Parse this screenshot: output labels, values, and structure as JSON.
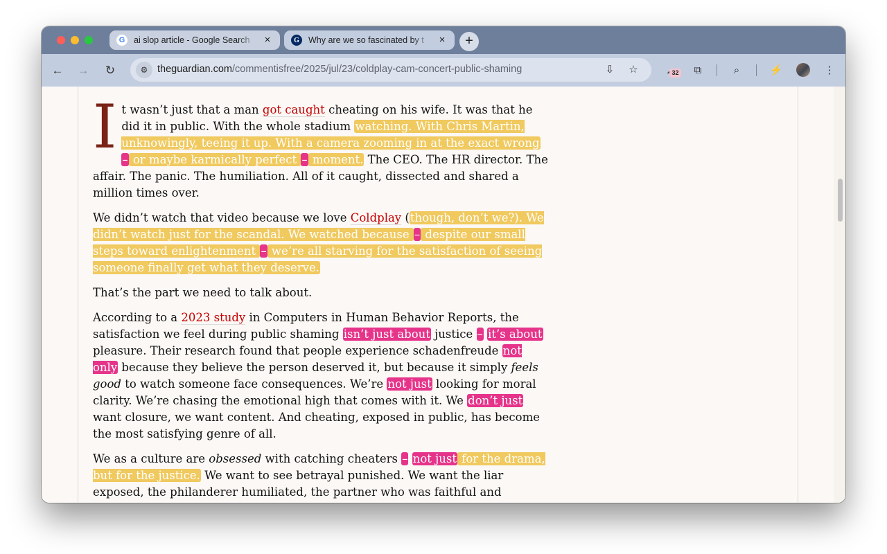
{
  "tabs": [
    {
      "title": "ai slop article - Google Search",
      "favicon": "google-icon",
      "active": false
    },
    {
      "title": "Why are we so fascinated by t",
      "favicon": "guardian-icon",
      "active": true
    }
  ],
  "toolbar": {
    "url_domain": "theguardian.com",
    "url_path": "/commentisfree/2025/jul/23/coldplay-cam-concert-public-shaming",
    "extension_badge": "32"
  },
  "article": {
    "p1": {
      "dropcap": "I",
      "s1": "t wasn’t just that a man ",
      "link": "got caught",
      "s2": " cheating on his wife. It was that he did it in public. With the whole stadium ",
      "h1": "watching. With Chris Martin, unknowingly, teeing it up. With a camera zooming in at the exact wrong",
      "d1": "–",
      "h2": " or maybe karmically perfect ",
      "d2": "–",
      "h3": " moment.",
      "s3": " The CEO. The HR director. The affair. The panic. The humiliation. All of it caught, dissected and shared a million times over."
    },
    "p2": {
      "s1": "We didn’t watch that video because we love ",
      "link": "Coldplay",
      "s2": " (",
      "h1": "though, don’t we?). We didn’t watch just for the scandal. We watched because ",
      "d1": "–",
      "h2": " despite our small steps toward enlightenment ",
      "d2": "–",
      "h3": " we’re all starving for the satisfaction of seeing someone finally get what they deserve."
    },
    "p3": "That’s the part we need to talk about.",
    "p4": {
      "s1": "According to a ",
      "link": "2023 study",
      "s2": " in Computers in Human Behavior Reports, the satisfaction we feel during public shaming ",
      "k1": "isn’t just about",
      "s3": " justice ",
      "d1": "–",
      "s4": " ",
      "k2": "it’s about",
      "s5": " pleasure. Their research found that people experience schadenfreude ",
      "k3": "not only",
      "s6": " because they believe the person deserved it, but because it simply ",
      "em": "feels good",
      "s7": " to watch someone face consequences. We’re ",
      "k4": "not just",
      "s8": " looking for moral clarity. We’re chasing the emotional high that comes with it. We ",
      "k5": "don’t just",
      "s9": " want closure, we want content. And cheating, exposed in public, has become the most satisfying genre of all."
    },
    "p5": {
      "s1": "We as a culture are ",
      "em": "obsessed",
      "s2": " with catching cheaters ",
      "d1": "–",
      "s3": " ",
      "k1": "not just",
      "h1": " for the drama, but for the justice.",
      "s4": " We want to see betrayal punished. We want the liar exposed, the philanderer humiliated, the partner who was faithful and"
    }
  },
  "colors": {
    "highlight_yellow": "#f0c95f",
    "highlight_pink": "#e6348a",
    "link_red": "#c70000",
    "dropcap": "#7a2216"
  }
}
